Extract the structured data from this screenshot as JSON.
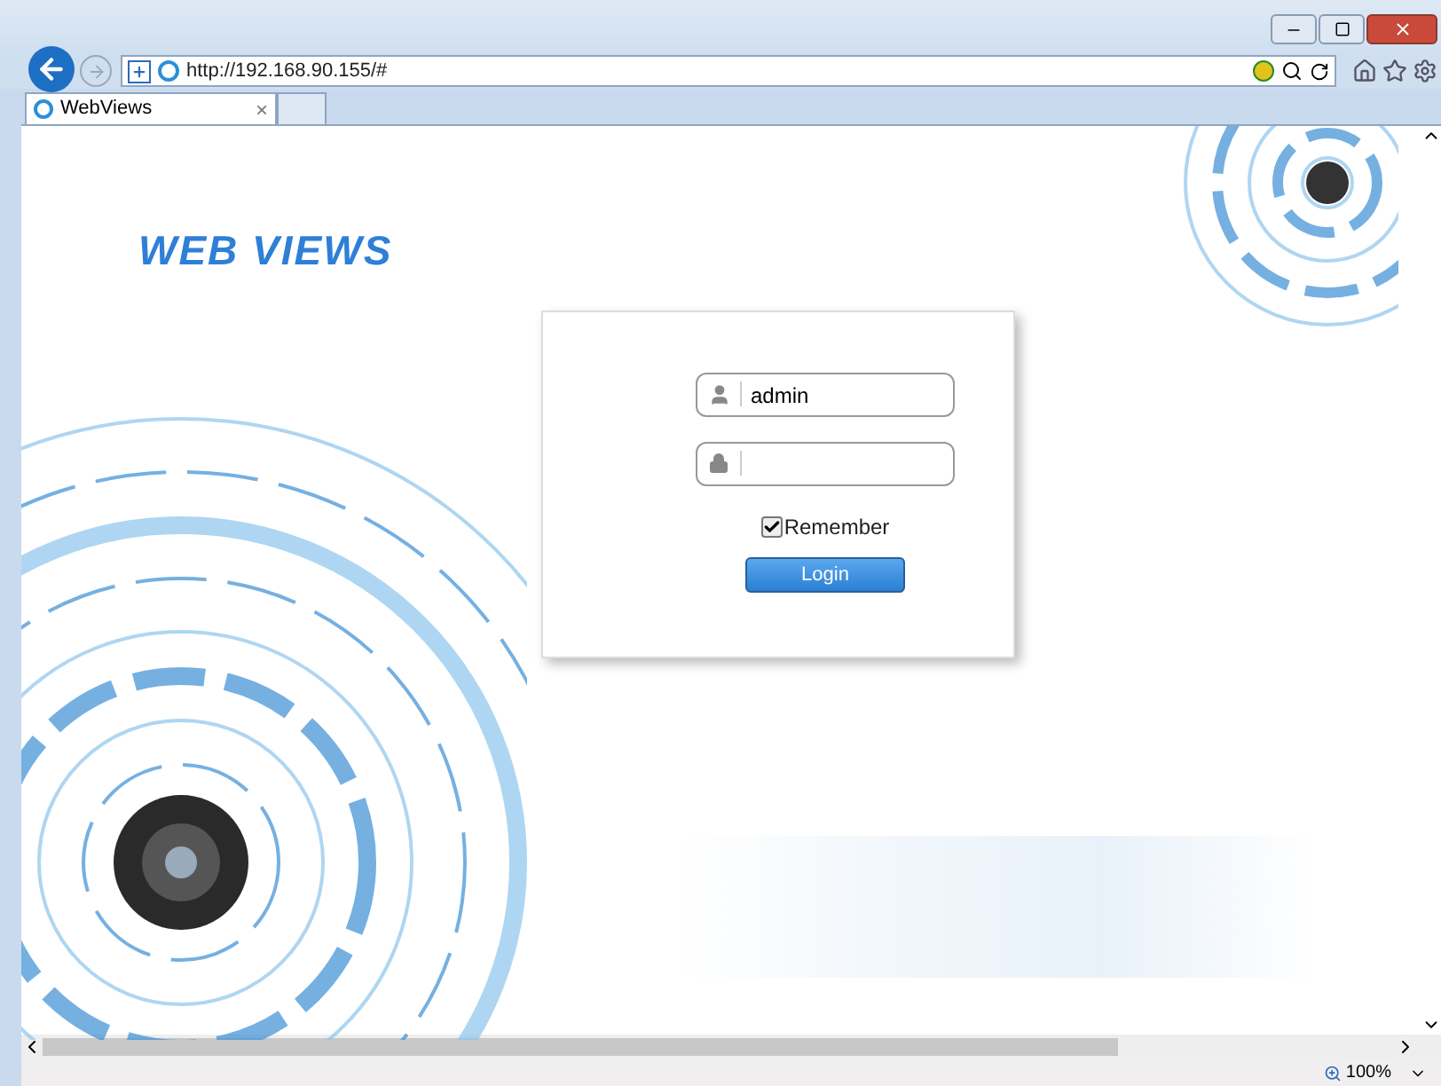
{
  "browser": {
    "address": "http://192.168.90.155/#",
    "tabs": [
      {
        "title": "WebViews",
        "close": "×",
        "selected": true
      }
    ],
    "zoom": "100%"
  },
  "page": {
    "logo": "WEB VIEWS",
    "login": {
      "username": {
        "value": "admin"
      },
      "remember": {
        "label": "Remember",
        "checked": true
      },
      "button": "Login"
    }
  }
}
